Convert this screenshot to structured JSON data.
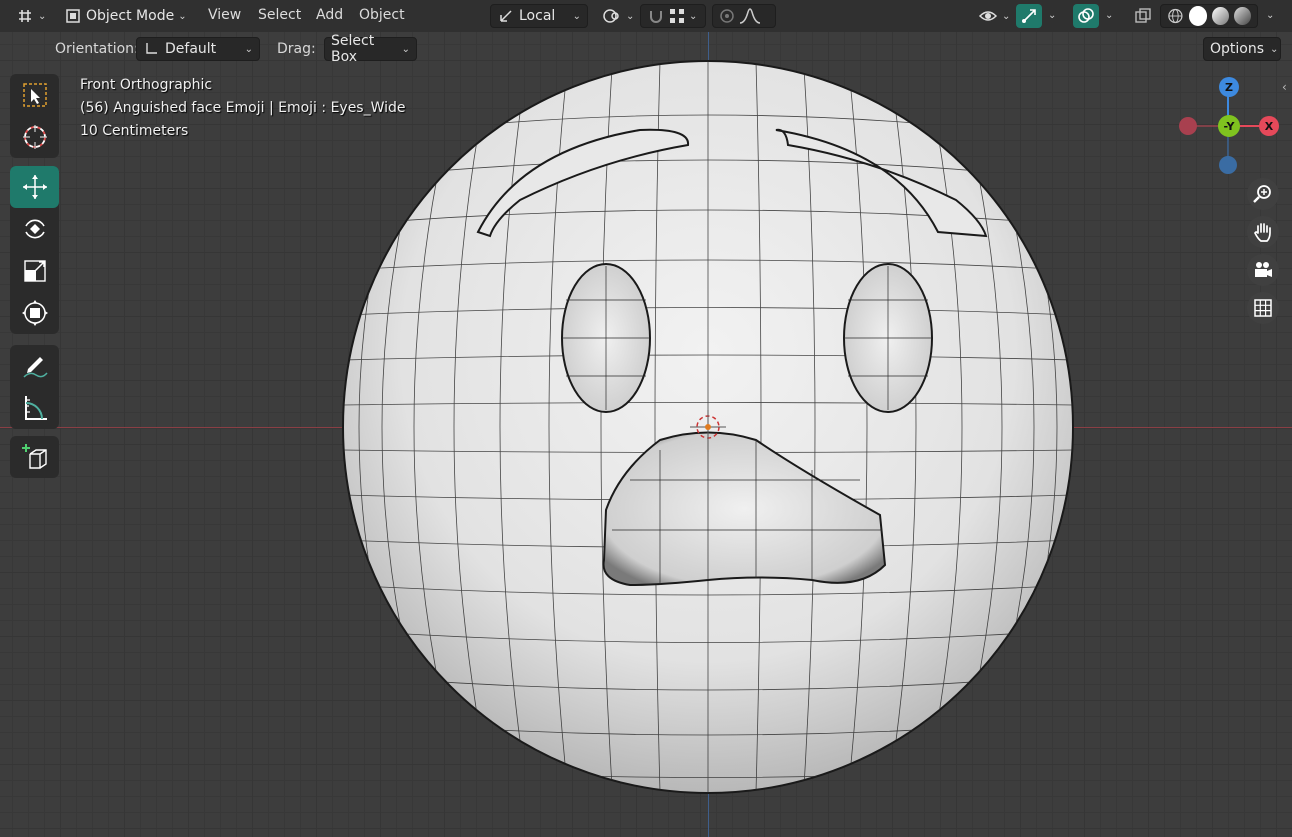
{
  "header": {
    "editor_type_icon": "grid-editor-icon",
    "mode_label": "Object Mode",
    "menus": [
      "View",
      "Select",
      "Add",
      "Object"
    ],
    "transform_orientation": "Local",
    "options_label": "Options"
  },
  "tool_settings": {
    "orientation_label": "Orientation:",
    "orientation_value": "Default",
    "drag_label": "Drag:",
    "drag_value": "Select Box"
  },
  "viewport_overlay": {
    "view_name": "Front Orthographic",
    "object_info": "(56) Anguished face Emoji | Emoji : Eyes_Wide",
    "grid_scale": "10 Centimeters"
  },
  "gizmo": {
    "z_label": "Z",
    "y_label": "-Y",
    "x_label": "X",
    "colors": {
      "x": "#e5495a",
      "y": "#7fc31f",
      "z": "#3d8ae0"
    }
  },
  "tools": [
    "select-box-icon",
    "cursor-icon",
    "move-icon",
    "rotate-icon",
    "scale-icon",
    "transform-icon",
    "annotate-icon",
    "measure-icon",
    "add-cube-icon"
  ],
  "nav_buttons": [
    "zoom-icon",
    "pan-hand-icon",
    "camera-icon",
    "ortho-grid-icon"
  ],
  "accent_color": "#1f7a6b"
}
